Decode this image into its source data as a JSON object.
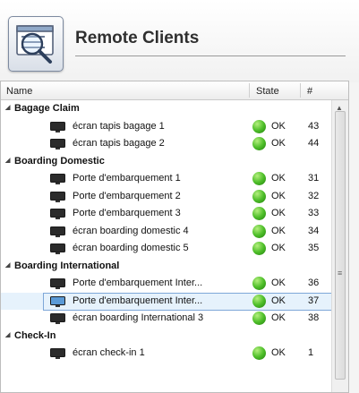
{
  "app": {
    "title": "Remote Clients"
  },
  "columns": {
    "name": "Name",
    "state": "State",
    "num": "#"
  },
  "scrollbar": {
    "up_glyph": "▲",
    "grip_glyph": "≡"
  },
  "groups": [
    {
      "label": "Bagage Claim",
      "items": [
        {
          "label": "écran tapis bagage 1",
          "state": "OK",
          "num": "43"
        },
        {
          "label": "écran tapis bagage 2",
          "state": "OK",
          "num": "44"
        }
      ]
    },
    {
      "label": "Boarding Domestic",
      "items": [
        {
          "label": "Porte d'embarquement 1",
          "state": "OK",
          "num": "31"
        },
        {
          "label": "Porte d'embarquement 2",
          "state": "OK",
          "num": "32"
        },
        {
          "label": "Porte d'embarquement 3",
          "state": "OK",
          "num": "33"
        },
        {
          "label": "écran boarding domestic 4",
          "state": "OK",
          "num": "34"
        },
        {
          "label": "écran boarding domestic 5",
          "state": "OK",
          "num": "35"
        }
      ]
    },
    {
      "label": "Boarding International",
      "items": [
        {
          "label": "Porte d'embarquement Inter...",
          "state": "OK",
          "num": "36"
        },
        {
          "label": "Porte d'embarquement Inter...",
          "state": "OK",
          "num": "37",
          "selected": true
        },
        {
          "label": "écran boarding International 3",
          "state": "OK",
          "num": "38"
        }
      ]
    },
    {
      "label": "Check-In",
      "items": [
        {
          "label": "écran check-in 1",
          "state": "OK",
          "num": "1"
        }
      ]
    }
  ],
  "colors": {
    "ok": "#3fb021",
    "selection": "#e6f2fc"
  }
}
